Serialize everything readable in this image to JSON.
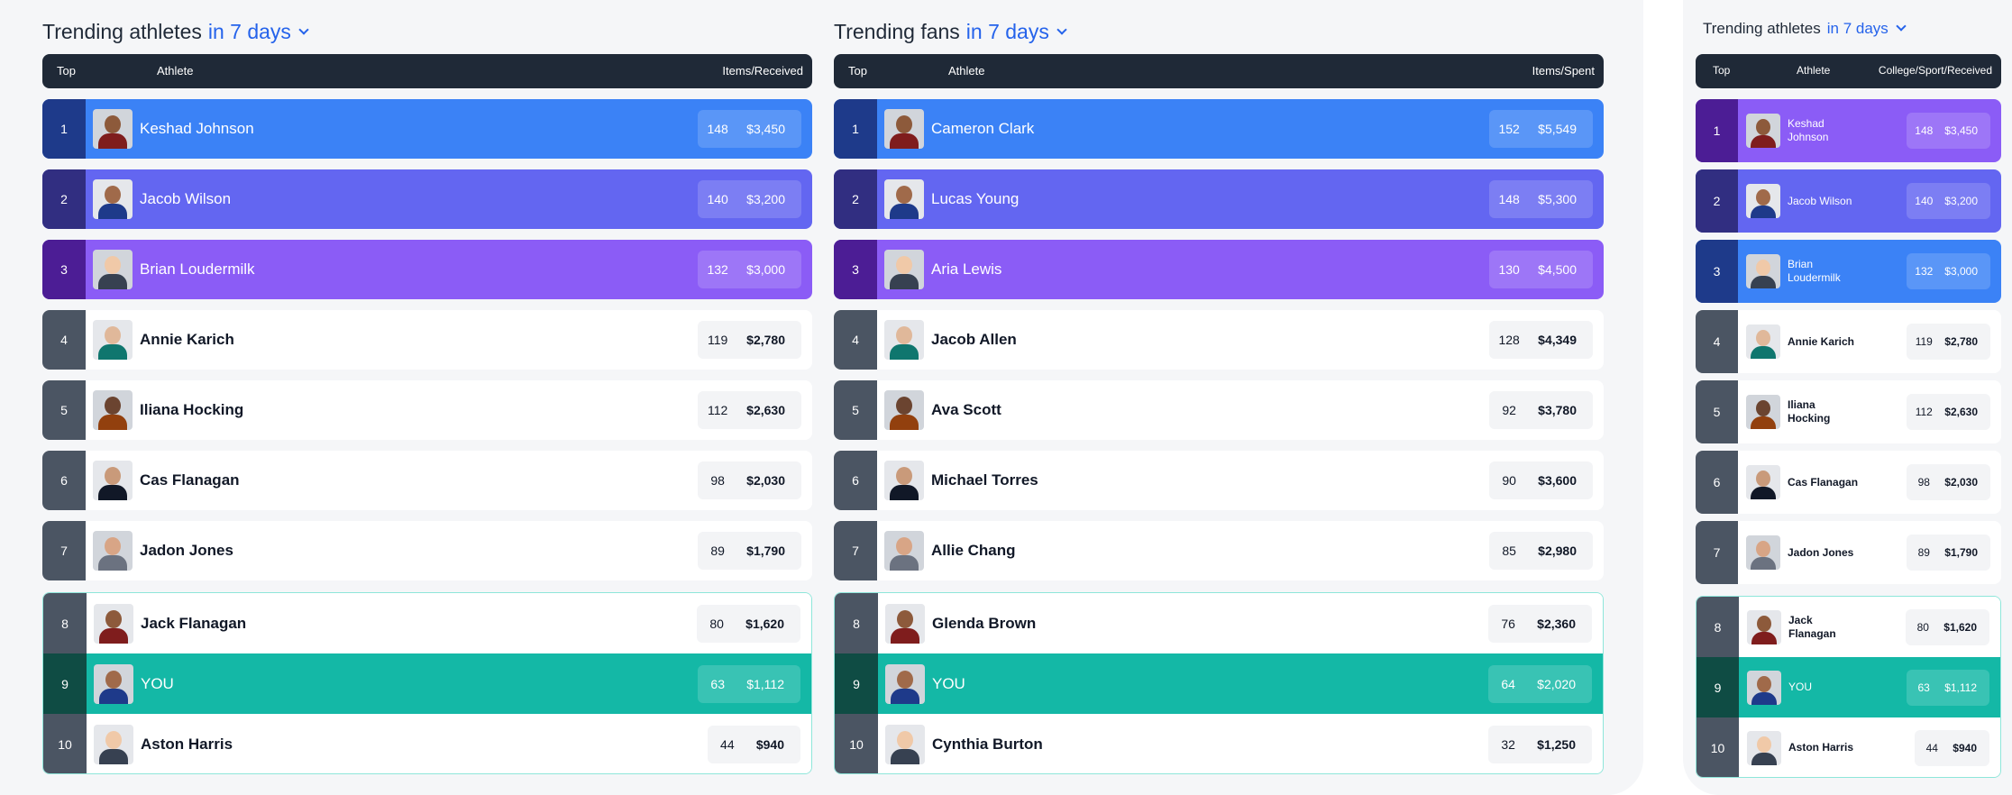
{
  "colors": {
    "blue": "#3b82f6",
    "indigo": "#6366f1",
    "violet": "#8b5cf6",
    "teal": "#14b8a6",
    "header": "#1f2937",
    "link": "#2563eb"
  },
  "athletes_panel": {
    "title": "Trending athletes",
    "range": "in 7 days",
    "col_top": "Top",
    "col_athlete": "Athlete",
    "col_stats": "Items/Received",
    "rows": [
      {
        "rank": "1",
        "name": "Keshad Johnson",
        "items": "148",
        "money": "$3,450",
        "style": "blue"
      },
      {
        "rank": "2",
        "name": "Jacob Wilson",
        "items": "140",
        "money": "$3,200",
        "style": "indigo"
      },
      {
        "rank": "3",
        "name": "Brian Loudermilk",
        "items": "132",
        "money": "$3,000",
        "style": "violet"
      },
      {
        "rank": "4",
        "name": "Annie Karich",
        "items": "119",
        "money": "$2,780",
        "style": "white"
      },
      {
        "rank": "5",
        "name": "Iliana Hocking",
        "items": "112",
        "money": "$2,630",
        "style": "white"
      },
      {
        "rank": "6",
        "name": "Cas Flanagan",
        "items": "98",
        "money": "$2,030",
        "style": "white"
      },
      {
        "rank": "7",
        "name": "Jadon Jones",
        "items": "89",
        "money": "$1,790",
        "style": "white"
      },
      {
        "rank": "8",
        "name": "Jack Flanagan",
        "items": "80",
        "money": "$1,620",
        "style": "white"
      },
      {
        "rank": "9",
        "name": "YOU",
        "items": "63",
        "money": "$1,112",
        "style": "teal"
      },
      {
        "rank": "10",
        "name": "Aston Harris",
        "items": "44",
        "money": "$940",
        "style": "white"
      }
    ]
  },
  "fans_panel": {
    "title": "Trending fans",
    "range": "in 7 days",
    "col_top": "Top",
    "col_athlete": "Athlete",
    "col_stats": "Items/Spent",
    "rows": [
      {
        "rank": "1",
        "name": "Cameron Clark",
        "items": "152",
        "money": "$5,549",
        "style": "blue"
      },
      {
        "rank": "2",
        "name": "Lucas Young",
        "items": "148",
        "money": "$5,300",
        "style": "indigo"
      },
      {
        "rank": "3",
        "name": "Aria Lewis",
        "items": "130",
        "money": "$4,500",
        "style": "violet"
      },
      {
        "rank": "4",
        "name": "Jacob Allen",
        "items": "128",
        "money": "$4,349",
        "style": "white"
      },
      {
        "rank": "5",
        "name": "Ava Scott",
        "items": "92",
        "money": "$3,780",
        "style": "white"
      },
      {
        "rank": "6",
        "name": "Michael Torres",
        "items": "90",
        "money": "$3,600",
        "style": "white"
      },
      {
        "rank": "7",
        "name": "Allie Chang",
        "items": "85",
        "money": "$2,980",
        "style": "white"
      },
      {
        "rank": "8",
        "name": "Glenda Brown",
        "items": "76",
        "money": "$2,360",
        "style": "white"
      },
      {
        "rank": "9",
        "name": "YOU",
        "items": "64",
        "money": "$2,020",
        "style": "teal"
      },
      {
        "rank": "10",
        "name": "Cynthia Burton",
        "items": "32",
        "money": "$1,250",
        "style": "white"
      }
    ]
  },
  "compact_panel": {
    "title": "Trending athletes",
    "range": "in 7 days",
    "col_top": "Top",
    "col_athlete": "Athlete",
    "col_stats": "College/Sport/Received",
    "rows": [
      {
        "rank": "1",
        "name": "Keshad Johnson",
        "items": "148",
        "money": "$3,450",
        "style": "violet"
      },
      {
        "rank": "2",
        "name": "Jacob Wilson",
        "items": "140",
        "money": "$3,200",
        "style": "indigo"
      },
      {
        "rank": "3",
        "name": "Brian Loudermilk",
        "items": "132",
        "money": "$3,000",
        "style": "blue"
      },
      {
        "rank": "4",
        "name": "Annie Karich",
        "items": "119",
        "money": "$2,780",
        "style": "white"
      },
      {
        "rank": "5",
        "name": "Iliana Hocking",
        "items": "112",
        "money": "$2,630",
        "style": "white"
      },
      {
        "rank": "6",
        "name": "Cas Flanagan",
        "items": "98",
        "money": "$2,030",
        "style": "white"
      },
      {
        "rank": "7",
        "name": "Jadon Jones",
        "items": "89",
        "money": "$1,790",
        "style": "white"
      },
      {
        "rank": "8",
        "name": "Jack Flanagan",
        "items": "80",
        "money": "$1,620",
        "style": "white"
      },
      {
        "rank": "9",
        "name": "YOU",
        "items": "63",
        "money": "$1,112",
        "style": "teal"
      },
      {
        "rank": "10",
        "name": "Aston Harris",
        "items": "44",
        "money": "$940",
        "style": "white"
      }
    ]
  }
}
